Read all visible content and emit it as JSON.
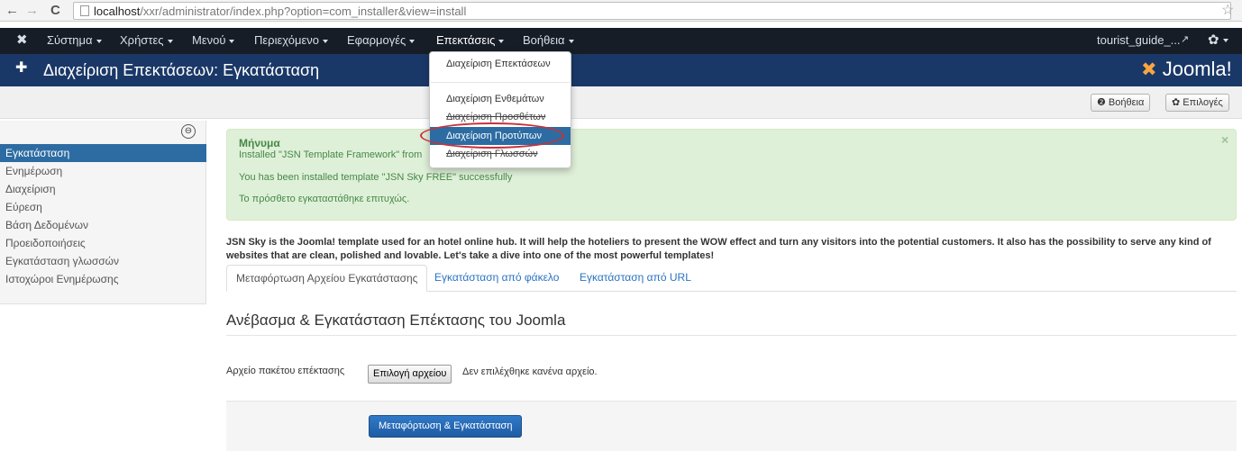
{
  "browser": {
    "back_glyph": "←",
    "forward_glyph": "→",
    "reload_glyph": "C",
    "url_host": "localhost",
    "url_path": "/xxr/administrator/index.php?option=com_installer&view=install",
    "star_glyph": "☆"
  },
  "menu": {
    "logo_glyph": "✖",
    "items": [
      "Σύστημα",
      "Χρήστες",
      "Μενού",
      "Περιεχόμενο",
      "Εφαρμογές",
      "Επεκτάσεις",
      "Βοήθεια"
    ],
    "user": "tourist_guide_...",
    "external_glyph": "↗",
    "gear_glyph": "✿"
  },
  "header": {
    "icon_glyph": "✚",
    "title": "Διαχείριση Επεκτάσεων: Εγκατάσταση",
    "logo_mark": "✖",
    "logo_text": "Joomla!"
  },
  "toolbar": {
    "help_label": "❷ Βοήθεια",
    "options_label": "✿ Επιλογές"
  },
  "sidebar": {
    "collapse_glyph": "⊖",
    "items": [
      "Εγκατάσταση",
      "Ενημέρωση",
      "Διαχείριση",
      "Εύρεση",
      "Βάση Δεδομένων",
      "Προειδοποιήσεις",
      "Εγκατάσταση γλωσσών",
      "Ιστοχώροι Ενημέρωσης"
    ],
    "active_index": 0
  },
  "message": {
    "heading": "Μήνυμα",
    "line1": "Installed \"JSN Template Framework\" from",
    "line2": "You has been installed template \"JSN Sky FREE\" successfully",
    "line3": "Το πρόσθετο εγκαταστάθηκε επιτυχώς.",
    "close_glyph": "×"
  },
  "description": "JSN Sky is the Joomla! template used for an hotel online hub. It will help the hoteliers to present the WOW effect and turn any visitors into the potential customers. It also has the possibility to serve any kind of websites that are clean, polished and lovable. Let's take a dive into one of the most powerful templates!",
  "tabs": [
    "Μεταφόρτωση Αρχείου Εγκατάστασης",
    "Εγκατάσταση από φάκελο",
    "Εγκατάσταση από URL"
  ],
  "section_title": "Ανέβασμα & Εγκατάσταση Επέκτασης του Joomla",
  "file": {
    "label": "Αρχείο πακέτου επέκτασης",
    "button": "Επιλογή αρχείου",
    "value": "Δεν επιλέχθηκε κανένα αρχείο."
  },
  "upload_button": "Μεταφόρτωση & Εγκατάσταση",
  "dropdown": {
    "items": [
      "Διαχείριση Επεκτάσεων",
      "Διαχείριση Ενθεμάτων",
      "Διαχείριση Προσθέτων",
      "Διαχείριση Προτύπων",
      "Διαχείριση Γλωσσών"
    ],
    "highlighted_index": 3
  },
  "colors": {
    "menubar": "#171d26",
    "header": "#1a3867",
    "accent": "#2d6ca2",
    "success_bg": "#dff0d8",
    "annotation": "#c9323a"
  }
}
